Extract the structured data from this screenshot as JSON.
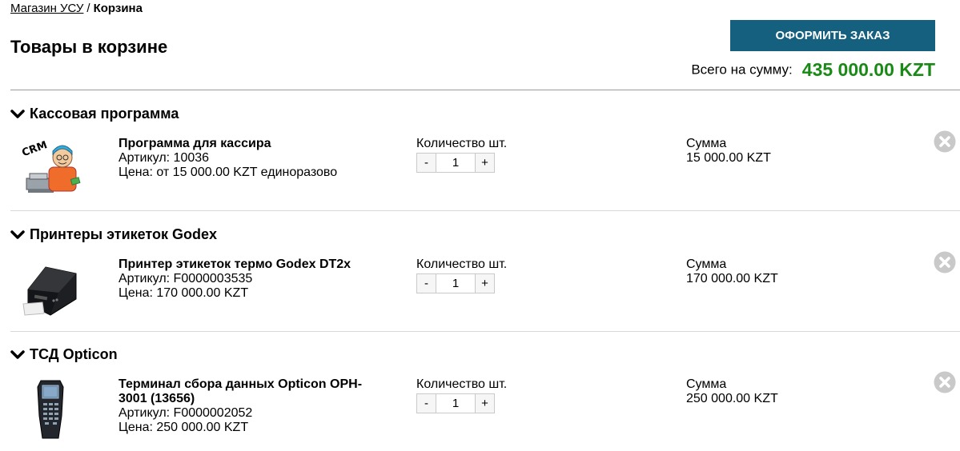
{
  "breadcrumb": {
    "home": "Магазин УСУ",
    "separator": "/",
    "current": "Корзина"
  },
  "page_title": "Товары в корзине",
  "checkout_label": "Оформить заказ",
  "total": {
    "label": "Всего на сумму:",
    "value": "435 000.00 KZT",
    "color": "#1a8a17"
  },
  "accent_color": "#15607f",
  "qty_label": "Количество шт.",
  "sum_label": "Сумма",
  "sections": [
    {
      "title": "Кассовая программа",
      "icon": "cashier-program-image",
      "product": {
        "name": "Программа для кассира",
        "sku": "Артикул: 10036",
        "price": "Цена: от 15 000.00 KZT единоразово",
        "qty": "1",
        "sum": "15 000.00 KZT"
      }
    },
    {
      "title": "Принтеры этикеток Godex",
      "icon": "label-printer-image",
      "product": {
        "name": "Принтер этикеток термо Godex DT2x",
        "sku": "Артикул: F0000003535",
        "price": "Цена: 170 000.00 KZT",
        "qty": "1",
        "sum": "170 000.00 KZT"
      }
    },
    {
      "title": "ТСД Opticon",
      "icon": "barcode-terminal-image",
      "product": {
        "name": "Терминал сбора данных Opticon OPH-3001 (13656)",
        "sku": "Артикул: F0000002052",
        "price": "Цена: 250 000.00 KZT",
        "qty": "1",
        "sum": "250 000.00 KZT"
      }
    }
  ],
  "qty_minus": "-",
  "qty_plus": "+",
  "crm_logo_text": "CRM"
}
